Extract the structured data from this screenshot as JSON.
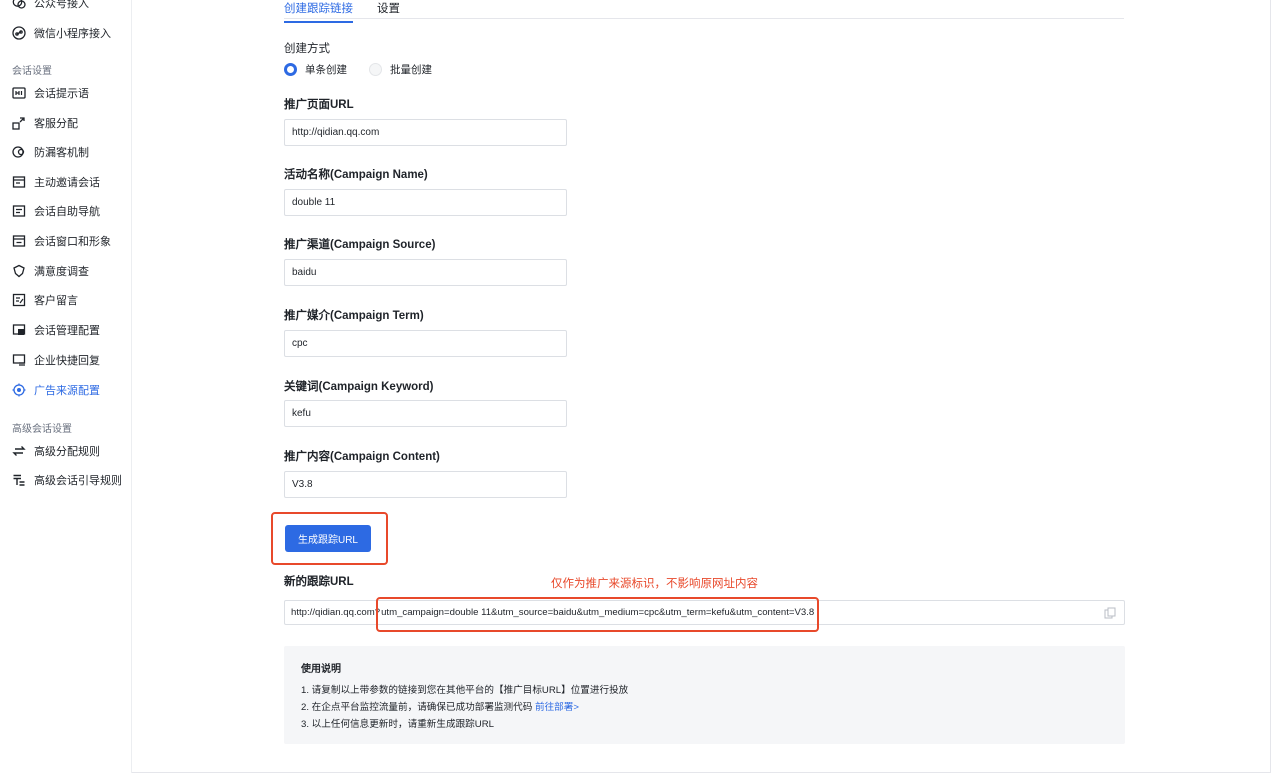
{
  "sidebar": {
    "top_items": [
      {
        "label": "公众号接入",
        "icon": "chat-link-icon"
      },
      {
        "label": "微信小程序接入",
        "icon": "miniprogram-icon"
      }
    ],
    "group1_title": "会话设置",
    "group1_items": [
      {
        "label": "会话提示语",
        "icon": "hi-icon"
      },
      {
        "label": "客服分配",
        "icon": "assign-icon"
      },
      {
        "label": "防漏客机制",
        "icon": "guard-icon"
      },
      {
        "label": "主动邀请会话",
        "icon": "invite-icon"
      },
      {
        "label": "会话自助导航",
        "icon": "nav-icon"
      },
      {
        "label": "会话窗口和形象",
        "icon": "window-icon"
      },
      {
        "label": "满意度调查",
        "icon": "survey-icon"
      },
      {
        "label": "客户留言",
        "icon": "message-icon"
      },
      {
        "label": "会话管理配置",
        "icon": "manage-icon"
      },
      {
        "label": "企业快捷回复",
        "icon": "quick-reply-icon"
      },
      {
        "label": "广告来源配置",
        "icon": "target-icon"
      }
    ],
    "group2_title": "高级会话设置",
    "group2_items": [
      {
        "label": "高级分配规则",
        "icon": "swap-icon"
      },
      {
        "label": "高级会话引导规则",
        "icon": "guide-icon"
      }
    ]
  },
  "tabs": [
    "创建跟踪链接",
    "设置"
  ],
  "form": {
    "mode_label": "创建方式",
    "mode_options": [
      "单条创建",
      "批量创建"
    ],
    "page_url_label": "推广页面URL",
    "page_url_value": "http://qidian.qq.com",
    "campaign_name_label": "活动名称(Campaign Name)",
    "campaign_name_value": "double 11",
    "campaign_source_label": "推广渠道(Campaign Source)",
    "campaign_source_value": "baidu",
    "campaign_term_label": "推广媒介(Campaign Term)",
    "campaign_term_value": "cpc",
    "campaign_keyword_label": "关键词(Campaign Keyword)",
    "campaign_keyword_value": "kefu",
    "campaign_content_label": "推广内容(Campaign Content)",
    "campaign_content_value": "V3.8",
    "generate_button": "生成跟踪URL"
  },
  "result": {
    "label": "新的跟踪URL",
    "annotation": "仅作为推广来源标识，不影响原网址内容",
    "url_prefix": "http://qidian.qq.com?",
    "url_params": "utm_campaign=double 11&utm_source=baidu&utm_medium=cpc&utm_term=kefu&utm_content=V3.8"
  },
  "help": {
    "title": "使用说明",
    "line1": "1. 请复制以上带参数的链接到您在其他平台的【推广目标URL】位置进行投放",
    "line2": "2. 在企点平台监控流量前，请确保已成功部署监测代码",
    "line2_link": "前往部署>",
    "line3": "3. 以上任何信息更新时，请重新生成跟踪URL"
  },
  "colors": {
    "accent": "#2d6ae3",
    "highlight": "#e8492b"
  }
}
